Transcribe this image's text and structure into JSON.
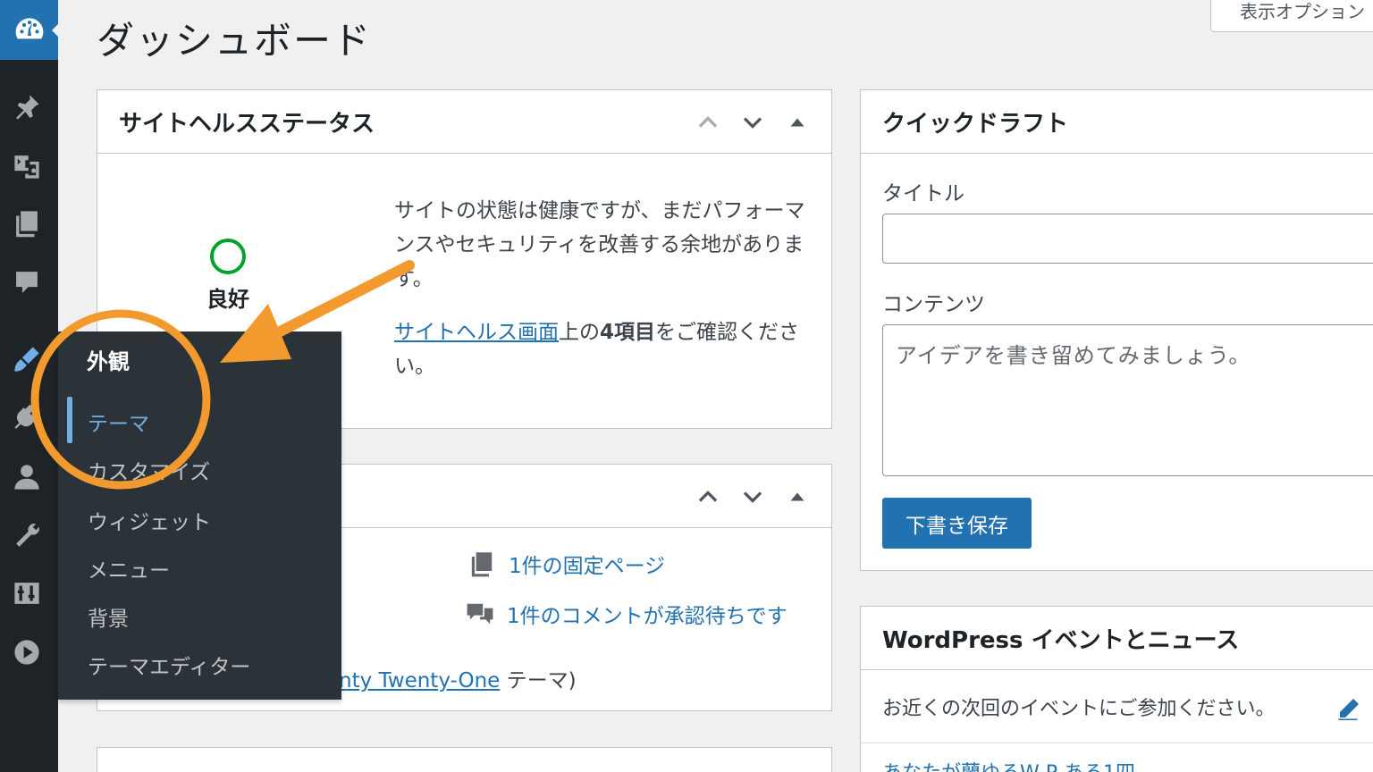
{
  "page": {
    "title": "ダッシュボード",
    "screen_options": "表示オプション"
  },
  "sidebar": {
    "items": [
      {
        "icon": "dashboard-icon"
      },
      {
        "icon": "pin-icon"
      },
      {
        "icon": "media-icon"
      },
      {
        "icon": "pages-icon"
      },
      {
        "icon": "comments-icon"
      },
      {
        "icon": "appearance-brush-icon",
        "active": true
      },
      {
        "icon": "plugins-icon"
      },
      {
        "icon": "users-icon"
      },
      {
        "icon": "tools-wrench-icon"
      },
      {
        "icon": "settings-sliders-icon"
      },
      {
        "icon": "media-play-icon"
      }
    ]
  },
  "site_health": {
    "title": "サイトヘルスステータス",
    "status": "良好",
    "status_color": "#00a32a",
    "message": "サイトの状態は健康ですが、まだパフォーマンスやセキュリティを改善する余地があります。",
    "link_text": "サイトヘルス画面",
    "message2_mid": "上の",
    "message2_bold": "4項目",
    "message2_end": "をご確認ください。"
  },
  "at_a_glance": {
    "pages": "1件の固定ページ",
    "comments": "1件のコメントが承認待ちです",
    "theme_link": "nty Twenty-One",
    "theme_suffix": " テーマ)"
  },
  "quick_draft": {
    "title": "クイックドラフト",
    "title_label": "タイトル",
    "content_label": "コンテンツ",
    "content_placeholder": "アイデアを書き留めてみましょう。",
    "save_button": "下書き保存"
  },
  "events": {
    "title": "WordPress イベントとニュース",
    "intro": "お近くの次回のイベントにご参加ください。",
    "row2": "あなたが蘭ゆるW    P    ある1四"
  },
  "flyout_menu": {
    "heading": "外観",
    "items": [
      "テーマ",
      "カスタマイズ",
      "ウィジェット",
      "メニュー",
      "背景",
      "テーマエディター"
    ],
    "current_index": 0
  },
  "annotation": {
    "color": "#f29a2e"
  }
}
